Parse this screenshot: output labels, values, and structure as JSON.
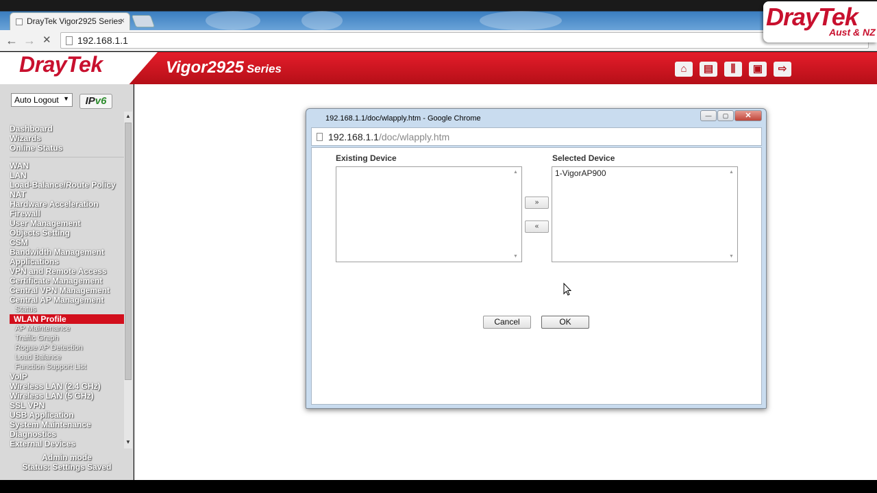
{
  "browser": {
    "tab_title": "DrayTek Vigor2925 Series",
    "tab_close": "×",
    "address": "192.168.1.1",
    "back_icon": "←",
    "forward_icon": "→",
    "reload_icon": "✕"
  },
  "brand_logo": {
    "line1": "DrayTek",
    "line2": "Aust & NZ"
  },
  "router": {
    "logo": "DrayTek",
    "model": "Vigor2925",
    "series": "Series",
    "header_icons": [
      {
        "name": "home-icon",
        "glyph": "⌂"
      },
      {
        "name": "quick-start-icon",
        "glyph": "▤"
      },
      {
        "name": "settings-icon",
        "glyph": "⫼"
      },
      {
        "name": "save-icon",
        "glyph": "▣"
      },
      {
        "name": "logout-icon",
        "glyph": "⇨"
      }
    ]
  },
  "sidebar": {
    "auto_logout": "Auto Logout",
    "ipv6_prefix": "IP",
    "ipv6_suffix": "v6",
    "menu": [
      {
        "label": "Dashboard",
        "type": "top"
      },
      {
        "label": "Wizards",
        "type": "top"
      },
      {
        "label": "Online Status",
        "type": "top"
      },
      {
        "type": "sep"
      },
      {
        "label": "WAN",
        "type": "top"
      },
      {
        "label": "LAN",
        "type": "top"
      },
      {
        "label": "Load-Balance/Route Policy",
        "type": "top"
      },
      {
        "label": "NAT",
        "type": "top"
      },
      {
        "label": "Hardware Acceleration",
        "type": "top"
      },
      {
        "label": "Firewall",
        "type": "top"
      },
      {
        "label": "User Management",
        "type": "top"
      },
      {
        "label": "Objects Setting",
        "type": "top"
      },
      {
        "label": "CSM",
        "type": "top"
      },
      {
        "label": "Bandwidth Management",
        "type": "top"
      },
      {
        "label": "Applications",
        "type": "top"
      },
      {
        "label": "VPN and Remote Access",
        "type": "top"
      },
      {
        "label": "Certificate Management",
        "type": "top"
      },
      {
        "label": "Central VPN Management",
        "type": "top"
      },
      {
        "label": "Central AP Management",
        "type": "top"
      },
      {
        "label": "Status",
        "type": "sub"
      },
      {
        "label": "WLAN Profile",
        "type": "active"
      },
      {
        "label": "AP Maintenance",
        "type": "sub"
      },
      {
        "label": "Traffic Graph",
        "type": "sub"
      },
      {
        "label": "Rogue AP Detection",
        "type": "sub"
      },
      {
        "label": "Load Balance",
        "type": "sub"
      },
      {
        "label": "Function Support List",
        "type": "sub"
      },
      {
        "label": "VoIP",
        "type": "top"
      },
      {
        "label": "Wireless LAN (2.4 GHz)",
        "type": "top"
      },
      {
        "label": "Wireless LAN (5 GHz)",
        "type": "top"
      },
      {
        "label": "SSL VPN",
        "type": "top"
      },
      {
        "label": "USB Application",
        "type": "top"
      },
      {
        "label": "System Maintenance",
        "type": "top"
      },
      {
        "label": "Diagnostics",
        "type": "top"
      },
      {
        "label": "External Devices",
        "type": "top"
      }
    ],
    "mode": "Admin mode",
    "status": "Status: Settings Saved"
  },
  "popup": {
    "title": "192.168.1.1/doc/wlapply.htm - Google Chrome",
    "address_host": "192.168.1.1",
    "address_path": "/doc/wlapply.htm",
    "existing_label": "Existing Device",
    "selected_label": "Selected Device",
    "existing_items": [],
    "selected_items": [
      "1-VigorAP900"
    ],
    "add_button": "»",
    "remove_button": "«",
    "cancel_button": "Cancel",
    "ok_button": "OK",
    "minimize": "—",
    "maximize": "▢",
    "close": "✕"
  }
}
